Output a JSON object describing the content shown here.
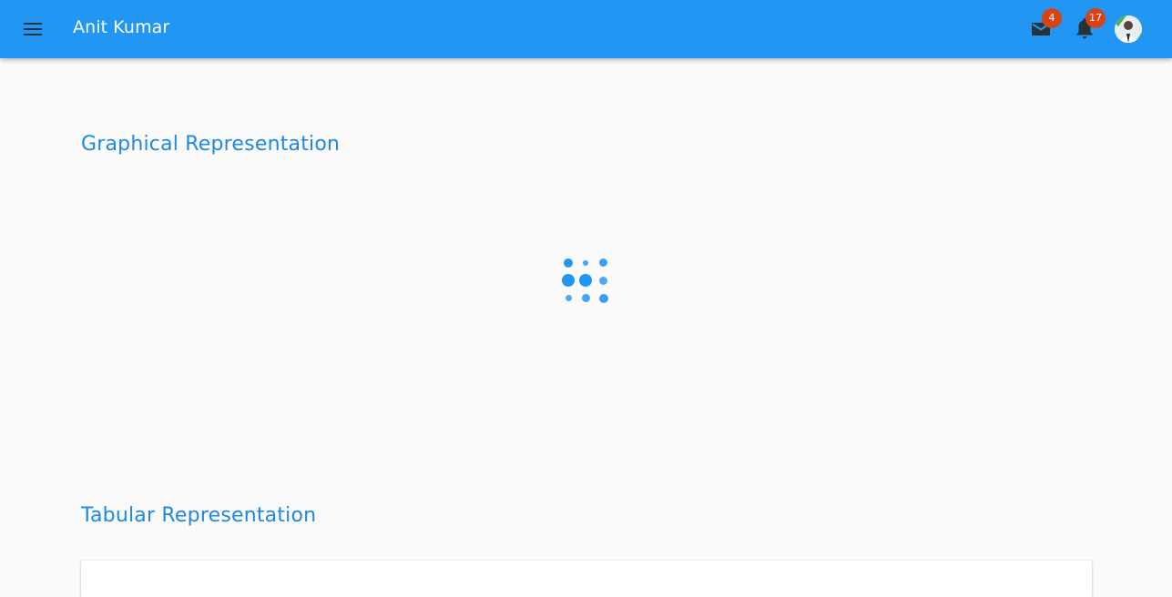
{
  "header": {
    "title": "Anit Kumar",
    "menu_icon": "menu-icon",
    "mail_icon": "mail-icon",
    "mail_count": "4",
    "notifications_icon": "bell-icon",
    "notifications_count": "17",
    "avatar_icon": "user-avatar"
  },
  "main": {
    "graph_title": "Graphical Representation",
    "loading_icon": "dots-spinner-icon",
    "table_title": "Tabular Representation"
  },
  "colors": {
    "primary": "#2196f3",
    "title_blue": "#1e88e5",
    "badge": "#d84315",
    "background": "#fafafa"
  }
}
